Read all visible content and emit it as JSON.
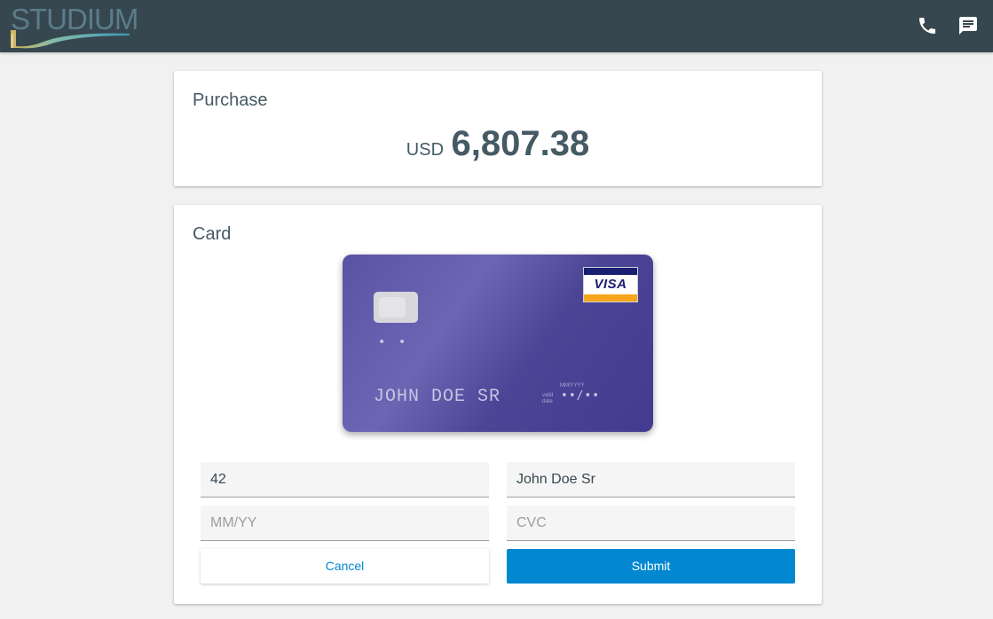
{
  "header": {
    "logo_text": "STUDIUM",
    "phone_icon": "phone-icon",
    "chat_icon": "chat-icon",
    "background": "#37474f"
  },
  "purchase": {
    "title": "Purchase",
    "currency": "USD",
    "amount": "6,807.38"
  },
  "card": {
    "title": "Card",
    "preview": {
      "number": "• •",
      "holder": "JOHN DOE SR",
      "expiry_hint": "MM/YYYY",
      "valid_label_1": "valid",
      "valid_label_2": "date",
      "expiry": "••/••",
      "brand": "VISA",
      "background": "#4c4596"
    },
    "fields": {
      "number_value": "42",
      "name_value": "John Doe Sr",
      "expiry_placeholder": "MM/YY",
      "cvc_placeholder": "CVC"
    },
    "buttons": {
      "cancel": "Cancel",
      "submit": "Submit"
    },
    "accent": "#0288d1"
  }
}
